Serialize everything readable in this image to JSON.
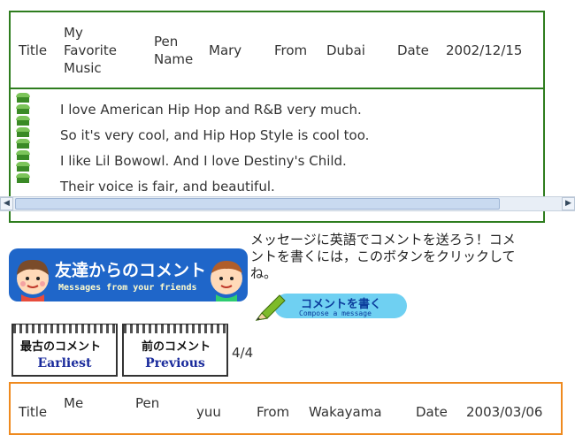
{
  "top_message": {
    "header": {
      "title_label": "Title",
      "title_value_line1": "My",
      "title_value_line2": "Favorite",
      "title_value_line3": "Music",
      "pen_label_line1": "Pen",
      "pen_label_line2": "Name",
      "pen_value": "Mary",
      "from_label": "From",
      "from_value": "Dubai",
      "date_label": "Date",
      "date_value": "2002/12/15"
    },
    "lines": [
      "I love American Hip Hop and R&B very much.",
      "So it's very cool, and Hip Hop Style is cool too.",
      "I like Lil Bowowl.  And I love Destiny's Child.",
      "Their voice is fair, and beautiful."
    ]
  },
  "banner": {
    "title": "友達からのコメント",
    "subtitle": "Messages from your friends"
  },
  "info_text": "メッセージに英語でコメントを送ろう！コメントを書くには，このボタンをクリックしてね。",
  "compose_button": {
    "label": "コメントを書く",
    "sublabel": "Compose a message"
  },
  "nav": {
    "earliest_top": "最古のコメント",
    "earliest_bottom": "Earliest",
    "previous_top": "前のコメント",
    "previous_bottom": "Previous",
    "page_count": "4/4"
  },
  "bottom_message": {
    "title_label": "Title",
    "title_value": "Me",
    "pen_label": "Pen",
    "pen_value": "yuu",
    "from_label": "From",
    "from_value": "Wakayama",
    "date_label": "Date",
    "date_value": "2003/03/06"
  },
  "colors": {
    "top_border": "#2e7d1e",
    "bottom_border": "#ef8a1e",
    "banner_blue": "#1f66c9",
    "compose_blue": "#6fd0f2"
  },
  "icons": {
    "book_icon": "book-stack-icon",
    "scroll_left": "chevron-left-icon",
    "scroll_right": "chevron-right-icon"
  }
}
